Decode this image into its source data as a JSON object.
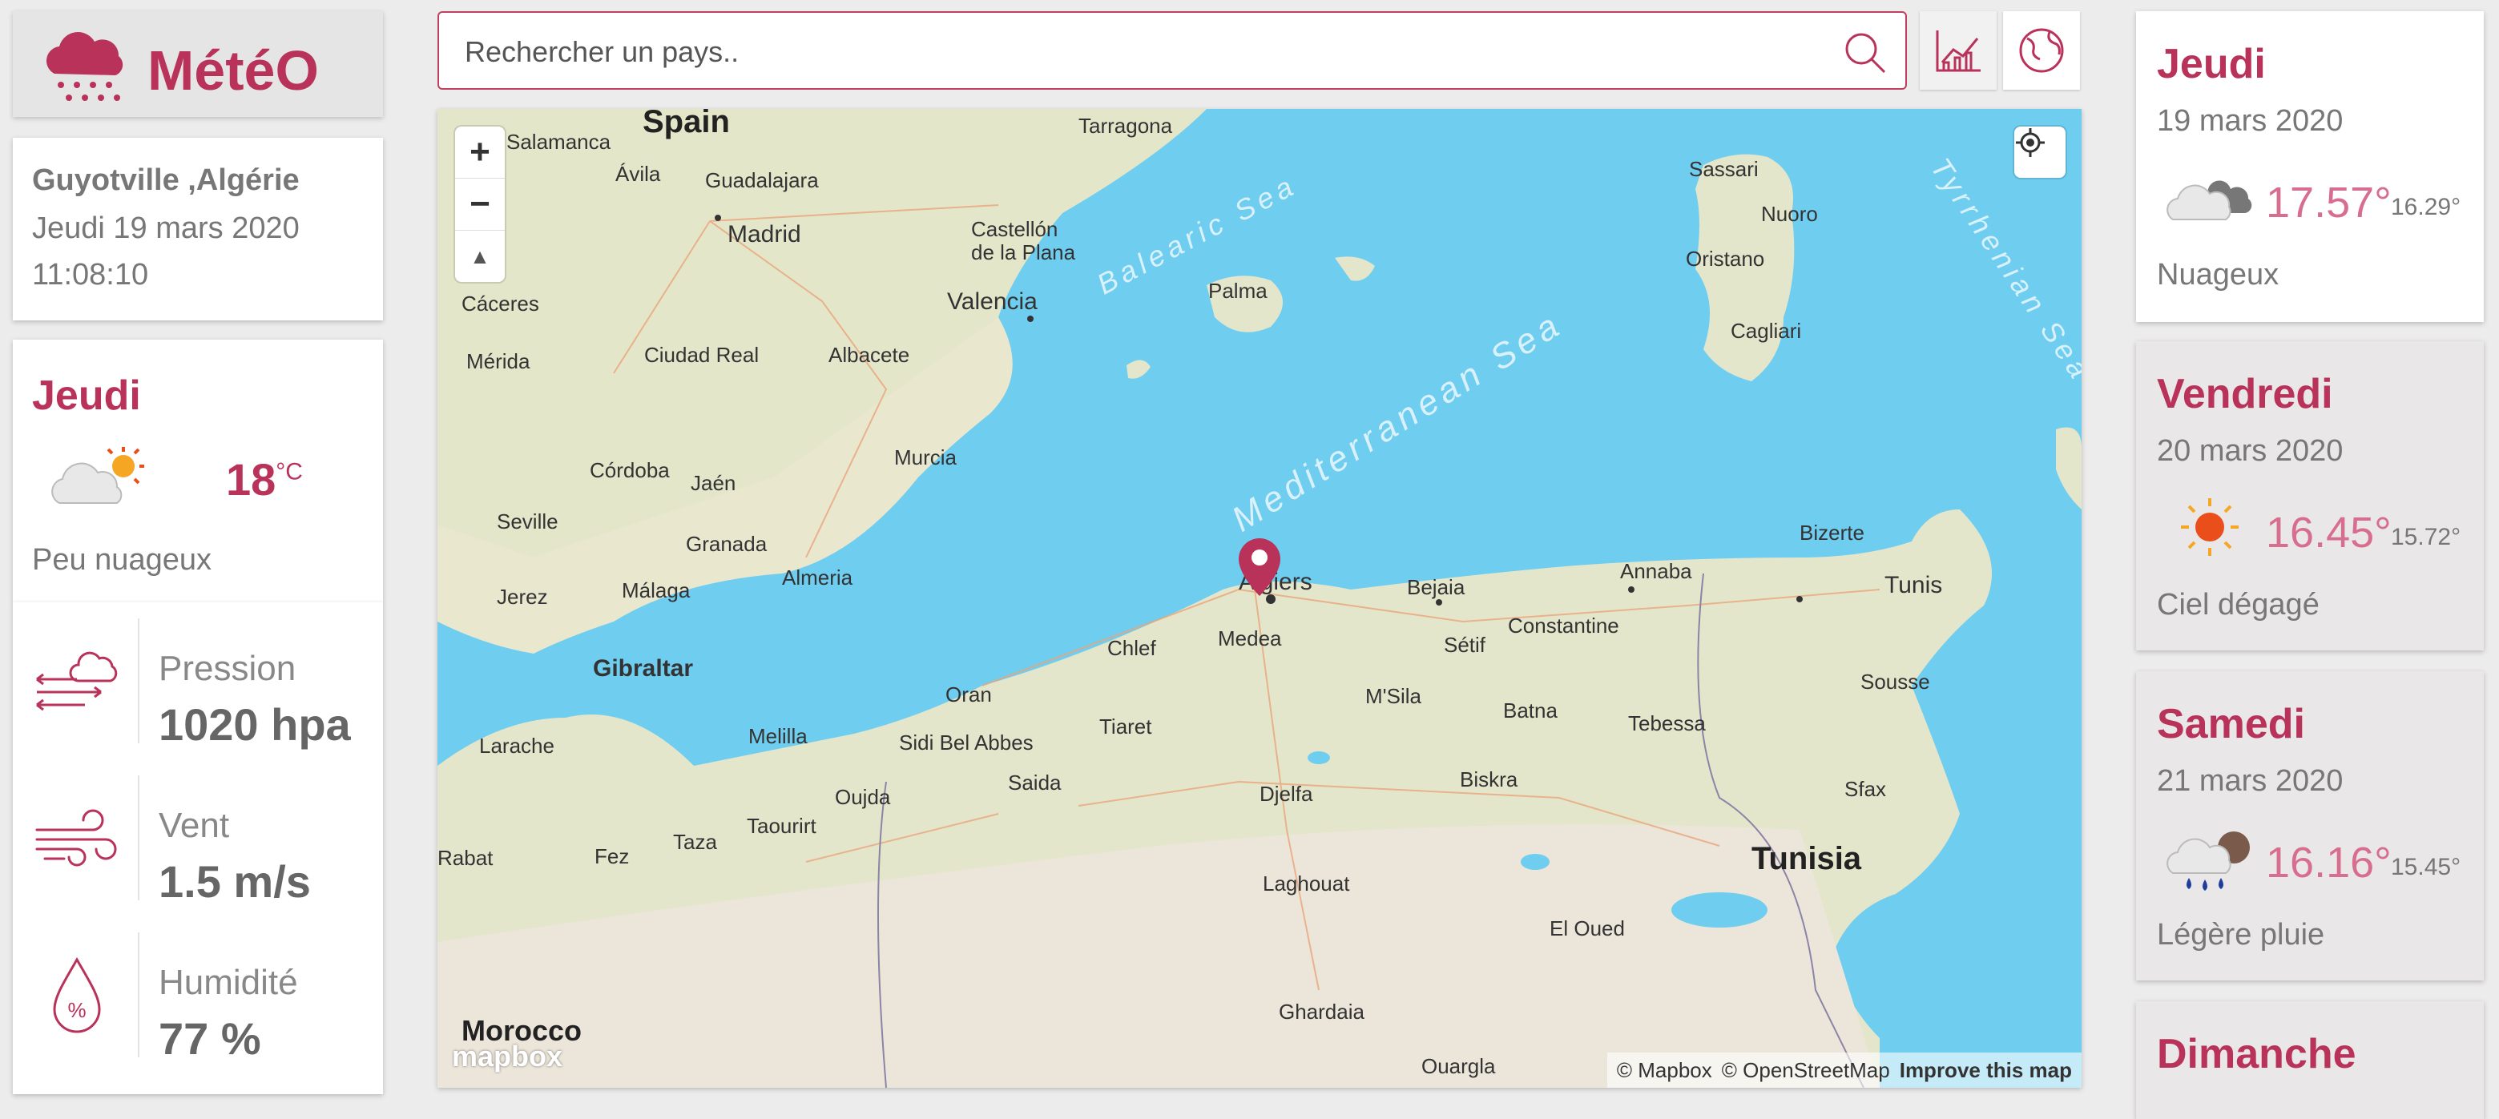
{
  "app": {
    "title": "MétéO",
    "logo_icon": "snow-cloud-icon",
    "brand_color": "#b8325a"
  },
  "location": {
    "city": "Guyotville ,Algérie",
    "date": "Jeudi 19 mars 2020",
    "time": "11:08:10"
  },
  "current": {
    "day": "Jeudi",
    "temp": "18",
    "unit": "°C",
    "description": "Peu nuageux",
    "icon": "partly-cloudy-icon"
  },
  "details": [
    {
      "label": "Pression",
      "value": "1020 hpa",
      "icon": "wind-cloud-icon"
    },
    {
      "label": "Vent",
      "value": "1.5 m/s",
      "icon": "wind-icon"
    },
    {
      "label": "Humidité",
      "value": "77 %",
      "icon": "humidity-drop-icon"
    }
  ],
  "search": {
    "placeholder": "Rechercher un pays..",
    "value": ""
  },
  "toolbar": {
    "chart_icon": "chart-icon",
    "globe_icon": "globe-icon"
  },
  "map": {
    "labels": {
      "spain": "Spain",
      "salamanca": "Salamanca",
      "avila": "Ávila",
      "guadalajara": "Guadalajara",
      "madrid": "Madrid",
      "tarragona": "Tarragona",
      "castellon": "Castellón de la Plana",
      "caceres": "Cáceres",
      "valencia": "Valencia",
      "merida": "Mérida",
      "ciudad_real": "Ciudad Real",
      "albacete": "Albacete",
      "cordoba": "Córdoba",
      "jaen": "Jaén",
      "murcia": "Murcia",
      "seville": "Seville",
      "granada": "Granada",
      "almeria": "Almeria",
      "jerez": "Jerez",
      "malaga": "Málaga",
      "gibraltar": "Gibraltar",
      "palma": "Palma",
      "sassari": "Sassari",
      "nuoro": "Nuoro",
      "oristano": "Oristano",
      "cagliari": "Cagliari",
      "balearic": "Balearic Sea",
      "tyrrhenian": "Tyrrhenian Sea",
      "mediterranean": "Mediterranean Sea",
      "algiers": "Algiers",
      "bejaia": "Bejaia",
      "annaba": "Annaba",
      "bizerte": "Bizerte",
      "tunis": "Tunis",
      "chlef": "Chlef",
      "medea": "Medea",
      "setif": "Sétif",
      "constantine": "Constantine",
      "msila": "M'Sila",
      "batna": "Batna",
      "oran": "Oran",
      "tiaret": "Tiaret",
      "sousse": "Sousse",
      "tebessa": "Tebessa",
      "larache": "Larache",
      "melilla": "Melilla",
      "sidi_bel_abbes": "Sidi Bel Abbes",
      "saida": "Saida",
      "djelfa": "Djelfa",
      "biskra": "Biskra",
      "oujda": "Oujda",
      "taourirt": "Taourirt",
      "sfax": "Sfax",
      "tunisia": "Tunisia",
      "rabat": "Rabat",
      "fez": "Fez",
      "taza": "Taza",
      "laghouat": "Laghouat",
      "el_oued": "El Oued",
      "morocco": "Morocco",
      "ghardaia": "Ghardaia",
      "ouargla": "Ouargla"
    },
    "zoom_in": "+",
    "zoom_out": "−",
    "compass": "▲",
    "mapbox": "mapbox",
    "attribution": [
      "© Mapbox",
      "© OpenStreetMap"
    ],
    "improve": "Improve this map",
    "marker_icon": "map-pin-icon",
    "locate_icon": "geolocate-icon"
  },
  "forecast": [
    {
      "day": "Jeudi",
      "date": "19 mars 2020",
      "max": "17.57°",
      "min": "16.29°",
      "description": "Nuageux",
      "icon": "cloudy-icon"
    },
    {
      "day": "Vendredi",
      "date": "20 mars 2020",
      "max": "16.45°",
      "min": "15.72°",
      "description": "Ciel dégagé",
      "icon": "sun-icon"
    },
    {
      "day": "Samedi",
      "date": "21 mars 2020",
      "max": "16.16°",
      "min": "15.45°",
      "description": "Légère pluie",
      "icon": "rain-icon"
    },
    {
      "day": "Dimanche",
      "date": "",
      "max": "",
      "min": "",
      "description": "",
      "icon": ""
    }
  ]
}
